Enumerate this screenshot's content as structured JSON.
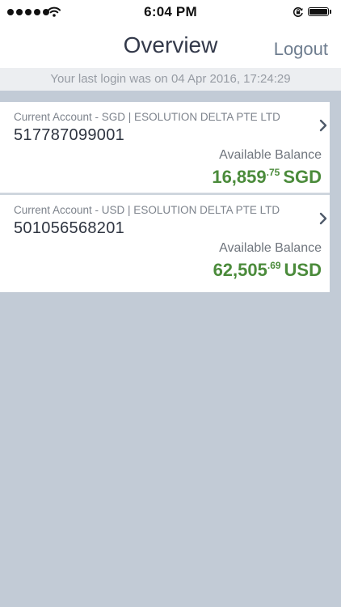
{
  "status_bar": {
    "time": "6:04 PM"
  },
  "header": {
    "title": "Overview",
    "logout_label": "Logout"
  },
  "last_login": "Your last login was on 04 Apr 2016, 17:24:29",
  "accounts": [
    {
      "label": "Current Account - SGD | ESOLUTION DELTA PTE LTD",
      "number": "517787099001",
      "available_label": "Available Balance",
      "balance_main": "16,859",
      "balance_cents": ".75",
      "currency": "SGD"
    },
    {
      "label": "Current Account - USD | ESOLUTION DELTA PTE LTD",
      "number": "501056568201",
      "available_label": "Available Balance",
      "balance_main": "62,505",
      "balance_cents": ".69",
      "currency": "USD"
    }
  ],
  "icons": {
    "signal": "signal-dots-icon",
    "wifi": "wifi-icon",
    "orientation_lock": "orientation-lock-icon",
    "battery": "battery-icon",
    "chevron": "chevron-right-icon"
  },
  "colors": {
    "balance": "#4b8b3b",
    "background": "#c2cbd6",
    "title": "#33394a",
    "logout": "#6e7d8f"
  }
}
